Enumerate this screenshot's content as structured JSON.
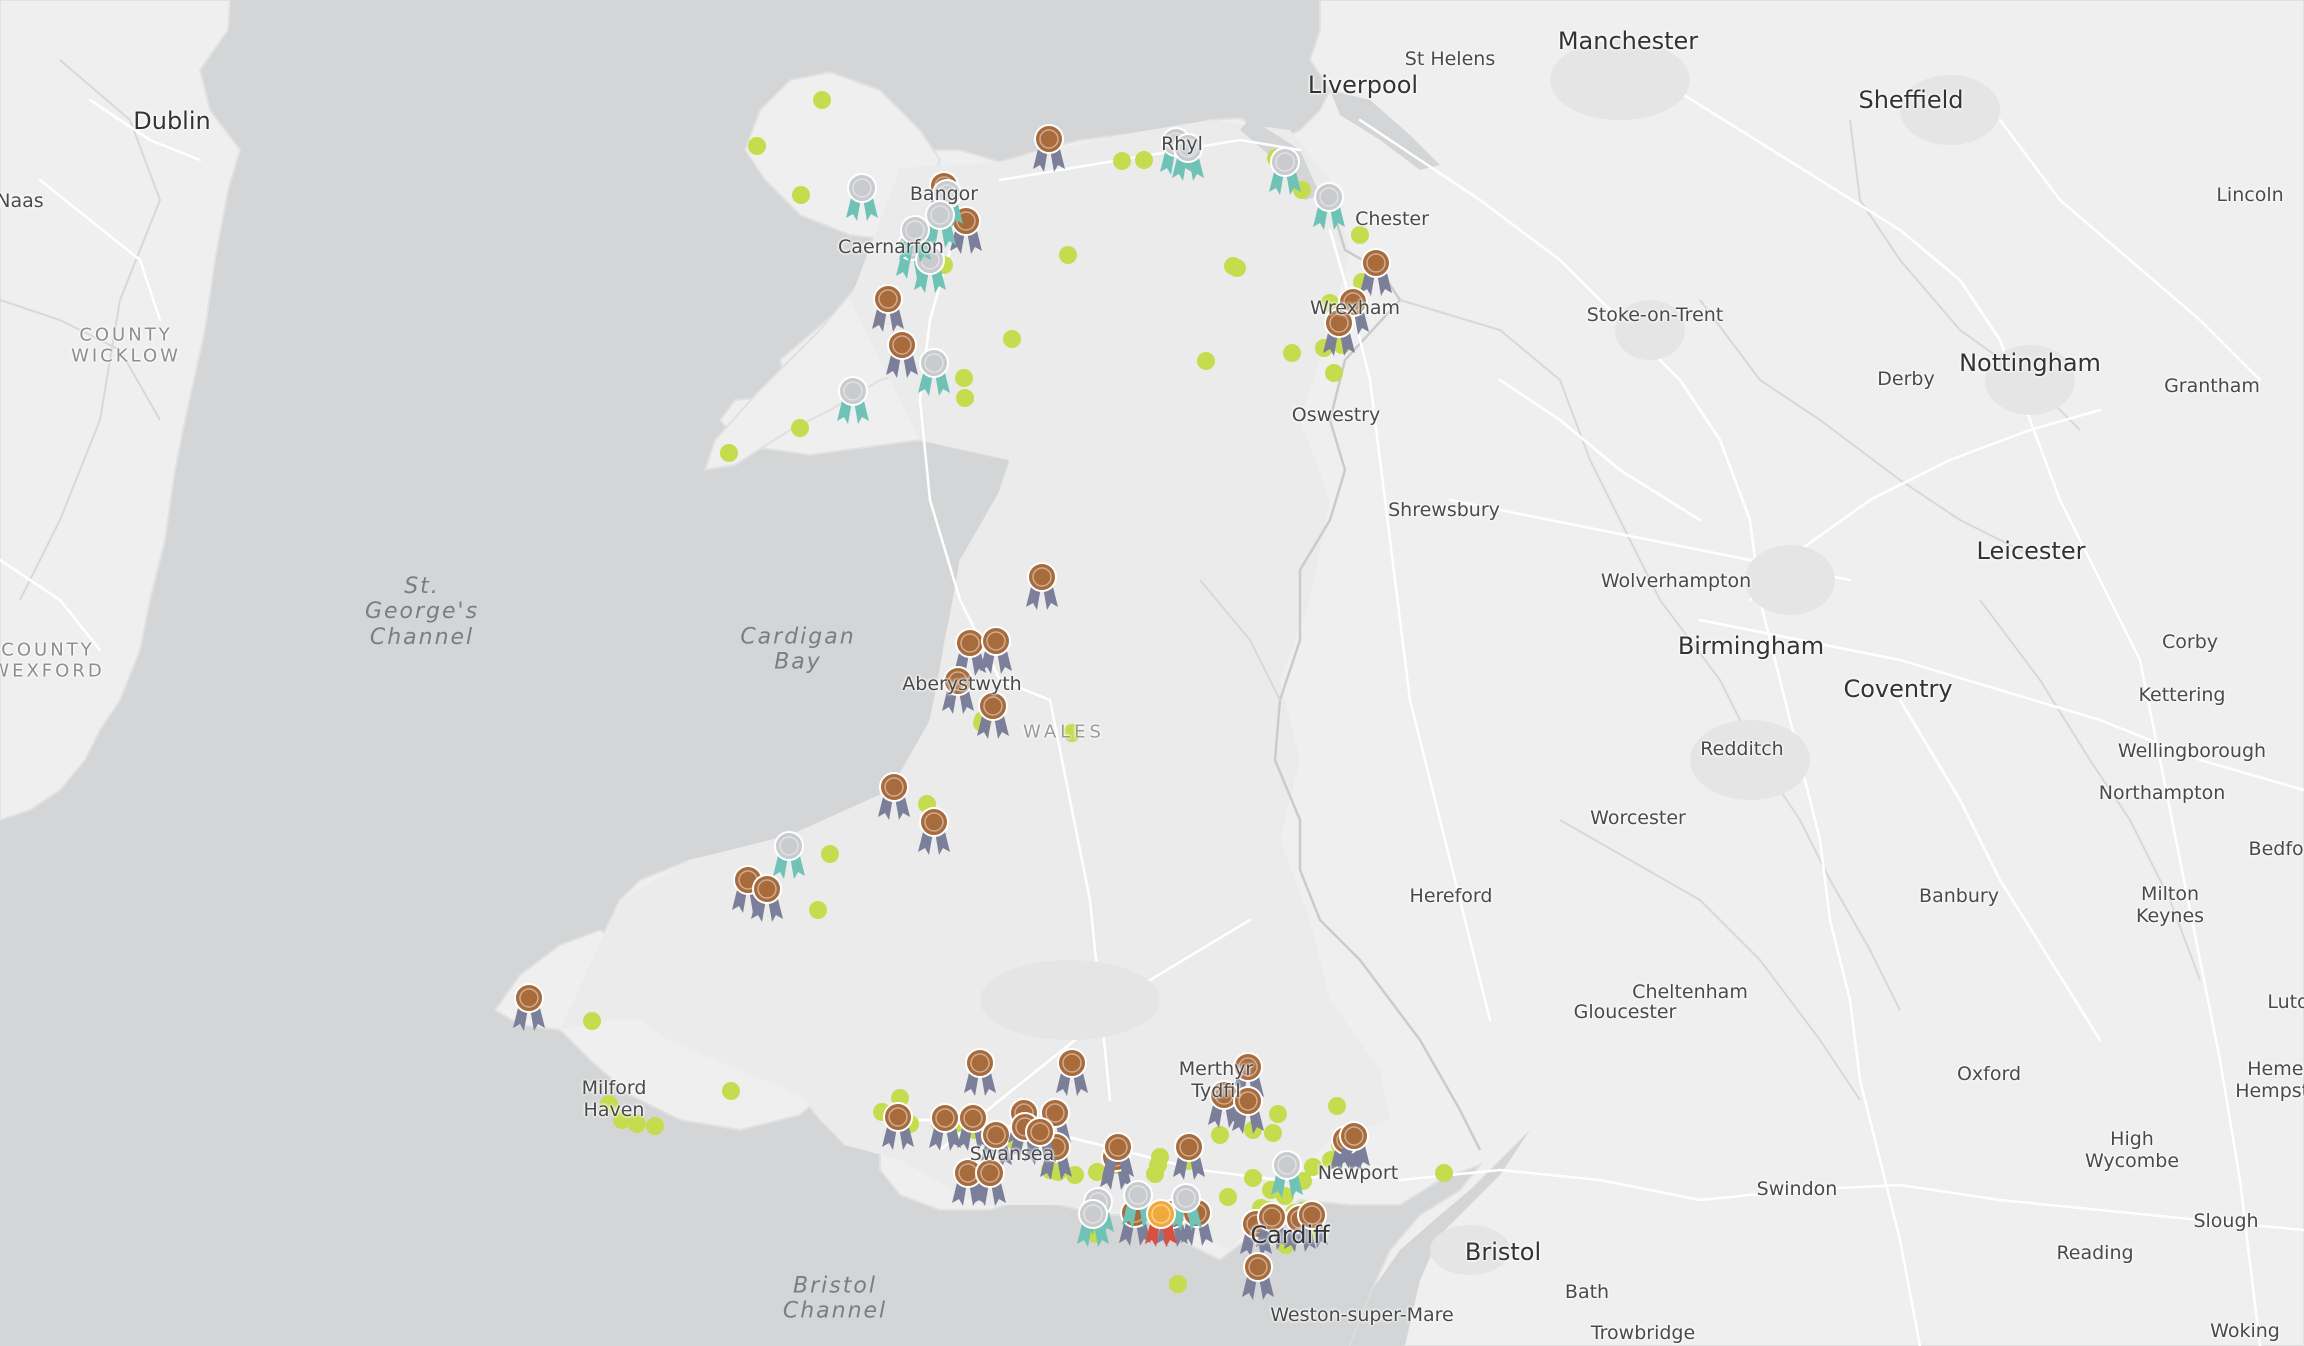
{
  "labels": [
    {
      "id": "manchester",
      "text": "Manchester",
      "kind": "city"
    },
    {
      "id": "st-helens",
      "text": "St Helens",
      "kind": "town"
    },
    {
      "id": "liverpool",
      "text": "Liverpool",
      "kind": "city"
    },
    {
      "id": "sheffield",
      "text": "Sheffield",
      "kind": "city"
    },
    {
      "id": "dublin",
      "text": "Dublin",
      "kind": "city"
    },
    {
      "id": "naas",
      "text": "Naas",
      "kind": "town"
    },
    {
      "id": "lincoln",
      "text": "Lincoln",
      "kind": "town"
    },
    {
      "id": "chester",
      "text": "Chester",
      "kind": "town"
    },
    {
      "id": "bangor",
      "text": "Bangor",
      "kind": "town"
    },
    {
      "id": "rhyl",
      "text": "Rhyl",
      "kind": "town"
    },
    {
      "id": "caernarfon",
      "text": "Caernarfon",
      "kind": "town"
    },
    {
      "id": "wrexham",
      "text": "Wrexham",
      "kind": "town"
    },
    {
      "id": "stoke",
      "text": "Stoke-on-Trent",
      "kind": "town"
    },
    {
      "id": "county-wicklow",
      "text": "COUNTY\nWICKLOW",
      "kind": "county"
    },
    {
      "id": "derby",
      "text": "Derby",
      "kind": "town"
    },
    {
      "id": "nottingham",
      "text": "Nottingham",
      "kind": "city"
    },
    {
      "id": "grantham",
      "text": "Grantham",
      "kind": "town"
    },
    {
      "id": "oswestry",
      "text": "Oswestry",
      "kind": "town"
    },
    {
      "id": "shrewsbury",
      "text": "Shrewsbury",
      "kind": "town"
    },
    {
      "id": "leicester",
      "text": "Leicester",
      "kind": "city"
    },
    {
      "id": "wolverhampton",
      "text": "Wolverhampton",
      "kind": "town"
    },
    {
      "id": "st-georges",
      "text": "St.\nGeorge's\nChannel",
      "kind": "water"
    },
    {
      "id": "cardigan-bay",
      "text": "Cardigan\nBay",
      "kind": "water"
    },
    {
      "id": "birmingham",
      "text": "Birmingham",
      "kind": "city"
    },
    {
      "id": "corby",
      "text": "Corby",
      "kind": "town"
    },
    {
      "id": "county-wexford",
      "text": "COUNTY\nWEXFORD",
      "kind": "county"
    },
    {
      "id": "aberystwyth",
      "text": "Aberystwyth",
      "kind": "town"
    },
    {
      "id": "coventry",
      "text": "Coventry",
      "kind": "city"
    },
    {
      "id": "kettering",
      "text": "Kettering",
      "kind": "town"
    },
    {
      "id": "wales",
      "text": "WALES",
      "kind": "region"
    },
    {
      "id": "redditch",
      "text": "Redditch",
      "kind": "town"
    },
    {
      "id": "wellingborough",
      "text": "Wellingborough",
      "kind": "town"
    },
    {
      "id": "northampton",
      "text": "Northampton",
      "kind": "town"
    },
    {
      "id": "worcester",
      "text": "Worcester",
      "kind": "town"
    },
    {
      "id": "bedford",
      "text": "Bedfor",
      "kind": "town"
    },
    {
      "id": "hereford",
      "text": "Hereford",
      "kind": "town"
    },
    {
      "id": "banbury",
      "text": "Banbury",
      "kind": "town"
    },
    {
      "id": "milton-keynes",
      "text": "Milton\nKeynes",
      "kind": "town"
    },
    {
      "id": "cheltenham",
      "text": "Cheltenham",
      "kind": "town"
    },
    {
      "id": "gloucester",
      "text": "Gloucester",
      "kind": "town"
    },
    {
      "id": "luton",
      "text": "Luto",
      "kind": "town"
    },
    {
      "id": "merthyr",
      "text": "Merthyr\nTydfil",
      "kind": "town"
    },
    {
      "id": "oxford",
      "text": "Oxford",
      "kind": "town"
    },
    {
      "id": "hemel",
      "text": "Hemel\nHempste",
      "kind": "town"
    },
    {
      "id": "milford-haven",
      "text": "Milford\nHaven",
      "kind": "town"
    },
    {
      "id": "high-wycombe",
      "text": "High\nWycombe",
      "kind": "town"
    },
    {
      "id": "swansea",
      "text": "Swansea",
      "kind": "town"
    },
    {
      "id": "newport",
      "text": "Newport",
      "kind": "town"
    },
    {
      "id": "swindon",
      "text": "Swindon",
      "kind": "town"
    },
    {
      "id": "slough",
      "text": "Slough",
      "kind": "town"
    },
    {
      "id": "cardiff",
      "text": "Cardiff",
      "kind": "city"
    },
    {
      "id": "bristol",
      "text": "Bristol",
      "kind": "city"
    },
    {
      "id": "reading",
      "text": "Reading",
      "kind": "town"
    },
    {
      "id": "bath",
      "text": "Bath",
      "kind": "town"
    },
    {
      "id": "bristol-channel",
      "text": "Bristol\nChannel",
      "kind": "water"
    },
    {
      "id": "weston",
      "text": "Weston-super-Mare",
      "kind": "town"
    },
    {
      "id": "trowbridge",
      "text": "Trowbridge",
      "kind": "town"
    },
    {
      "id": "woking",
      "text": "Woking",
      "kind": "town"
    }
  ],
  "marker_colors": {
    "beach_dot": "#c5dc4e",
    "bronze_medal": "#a86b3c",
    "bronze_ribbon": "#7b7f99",
    "silver_medal": "#c9cbce",
    "silver_ribbon": "#6fc2b6",
    "gold_medal": "#f2a93b",
    "gold_ribbon": "#d9503f"
  },
  "colors": {
    "sea": "#d3d5d6",
    "land": "#efefef",
    "wales_land": "#ebebeb",
    "roads": "#ffffff",
    "borders": "#c9c9c9"
  }
}
